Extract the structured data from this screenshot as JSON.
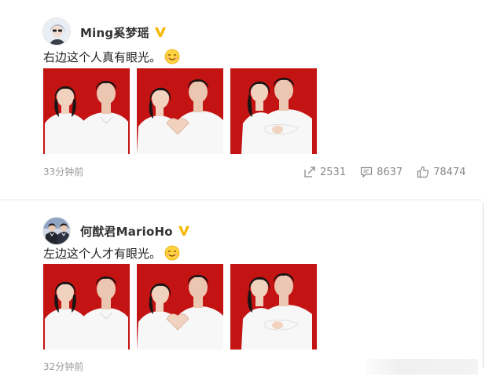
{
  "posts": [
    {
      "username": "Ming奚梦瑶",
      "text": "右边这个人真有眼光。",
      "time": "33分钟前",
      "verified_color": "#f5b800",
      "stats": {
        "repost": "2531",
        "comment": "8637",
        "like": "78474"
      },
      "emoji": "smile-emoji",
      "photos": [
        "couple-photo-1",
        "couple-photo-2",
        "couple-photo-3"
      ]
    },
    {
      "username": "何猷君MarioHo",
      "text": "左边这个人才有眼光。",
      "time": "32分钟前",
      "verified_color": "#f5b800",
      "emoji": "smile-emoji",
      "photos": [
        "couple-photo-1",
        "couple-photo-2",
        "couple-photo-3"
      ]
    }
  ],
  "colors": {
    "photo_bg": "#c41313",
    "shirt": "#f7f7f7",
    "skin": "#f1d2bf",
    "hair": "#1a1414"
  },
  "icons": {
    "repost": "repost-icon",
    "comment": "comment-icon",
    "like": "like-icon",
    "verified": "verified-v-icon"
  }
}
